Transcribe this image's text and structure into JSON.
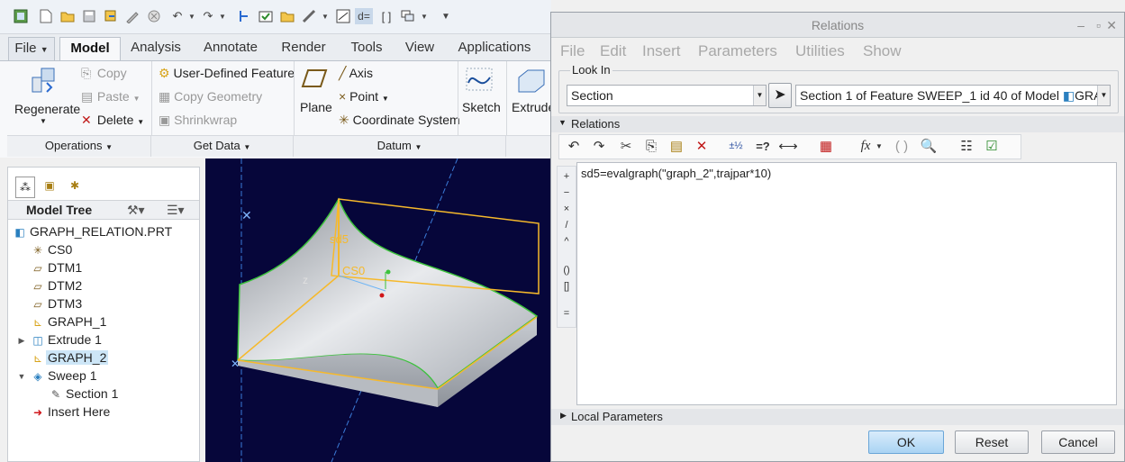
{
  "tabs": [
    "File",
    "Model",
    "Analysis",
    "Annotate",
    "Render",
    "Tools",
    "View",
    "Applications"
  ],
  "ribbon": {
    "regenerate": "Regenerate",
    "copy": "Copy",
    "paste": "Paste",
    "delete": "Delete",
    "udf": "User-Defined Feature",
    "copy_geometry": "Copy Geometry",
    "shrinkwrap": "Shrinkwrap",
    "plane": "Plane",
    "axis": "Axis",
    "point": "Point",
    "coord_system": "Coordinate System",
    "sketch": "Sketch",
    "extrude": "Extrude",
    "groups": [
      "Operations",
      "Get Data",
      "Datum"
    ]
  },
  "tree": {
    "title": "Model Tree",
    "items": [
      "GRAPH_RELATION.PRT",
      "CS0",
      "DTM1",
      "DTM2",
      "DTM3",
      "GRAPH_1",
      "Extrude 1",
      "GRAPH_2",
      "Sweep 1",
      "Section 1",
      "Insert Here"
    ]
  },
  "graphics": {
    "labels": [
      "sd5",
      "CS0",
      "z"
    ]
  },
  "dialog": {
    "title": "Relations",
    "menus": [
      "File",
      "Edit",
      "Insert",
      "Parameters",
      "Utilities",
      "Show"
    ],
    "look_in_label": "Look In",
    "look_in_type": "Section",
    "look_in_value": "Section 1 of Feature SWEEP_1 id 40 of Model",
    "look_in_model": "GRAP",
    "relations_label": "Relations",
    "relation_text": "sd5=evalgraph(\"graph_2\",trajpar*10)",
    "local_params_label": "Local Parameters",
    "ok": "OK",
    "reset": "Reset",
    "cancel": "Cancel"
  },
  "colors": {
    "graphics_bg": "#06063a",
    "selection": "#f6b92b",
    "accent": "#a9d3f3"
  }
}
